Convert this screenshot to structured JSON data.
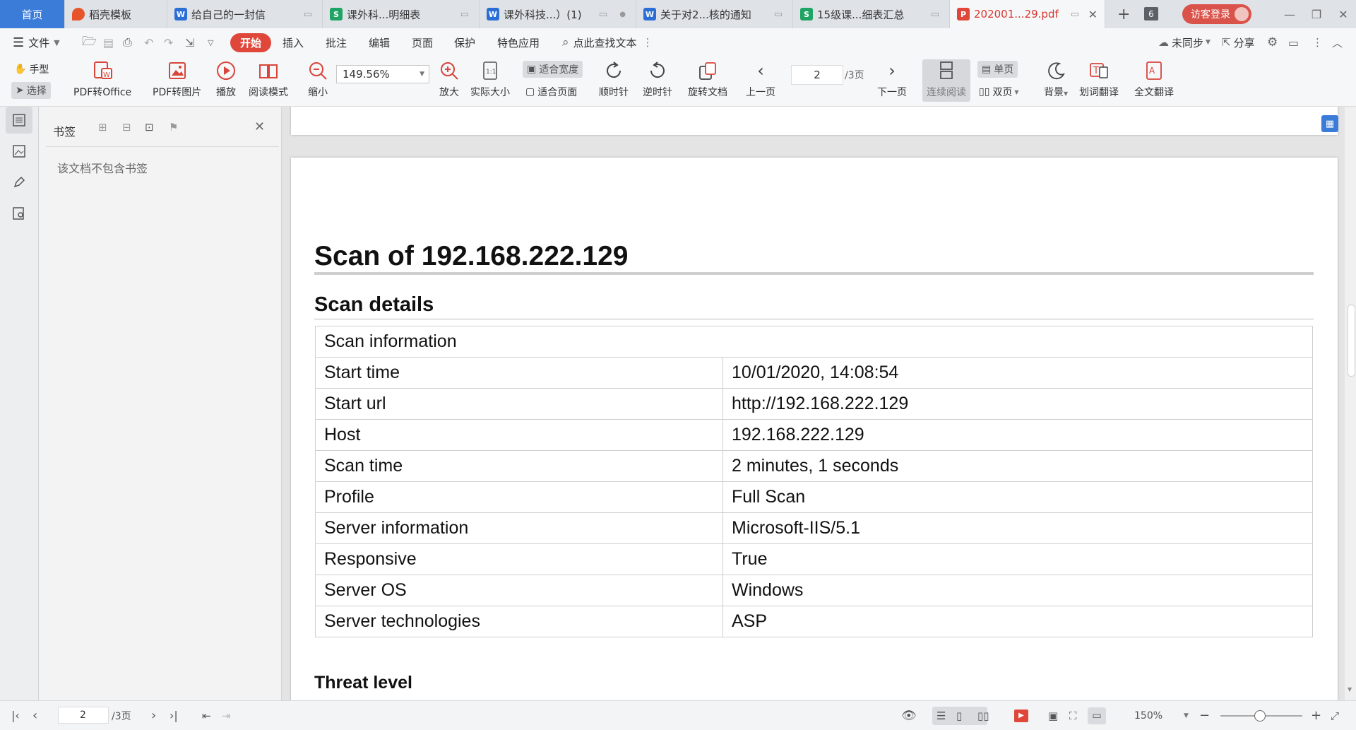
{
  "tabs": [
    {
      "label": "首页",
      "type": "home"
    },
    {
      "label": "稻壳模板",
      "icon": "docer-icon",
      "icon_color": "#e8542a"
    },
    {
      "label": "给自己的一封信",
      "icon": "word-icon",
      "icon_color": "#2b6fd6",
      "state": "cloud-unsynced-icon"
    },
    {
      "label": "课外科...明细表",
      "icon": "sheet-icon",
      "icon_color": "#1fa463",
      "state": "cloud-unsynced-icon"
    },
    {
      "label": "课外科技...）(1)",
      "icon": "word-icon",
      "icon_color": "#2b6fd6",
      "state": "cloud-unsynced-icon"
    },
    {
      "label": "关于对2...核的通知",
      "icon": "word-icon",
      "icon_color": "#2b6fd6",
      "state": "cloud-unsynced-icon"
    },
    {
      "label": "15级课...细表汇总",
      "icon": "sheet-icon",
      "icon_color": "#1fa463",
      "state": "cloud-unsynced-icon"
    },
    {
      "label": "202001...29.pdf",
      "icon": "pdf-icon",
      "icon_color": "#e0473b",
      "state": "cloud-unsynced-icon",
      "active": true
    }
  ],
  "tabbar": {
    "new_tab": "+",
    "tab_count": "6",
    "login_label": "访客登录"
  },
  "menu": {
    "file": "文件",
    "items": [
      "开始",
      "插入",
      "批注",
      "编辑",
      "页面",
      "保护",
      "特色应用"
    ],
    "search_placeholder": "点此查找文本",
    "unsynced": "未同步",
    "share": "分享"
  },
  "ribbon": {
    "hand": "手型",
    "select": "选择",
    "pdf_to_office": "PDF转Office",
    "pdf_to_image": "PDF转图片",
    "play": "播放",
    "read_mode": "阅读模式",
    "zoom_out": "缩小",
    "zoom_value": "149.56%",
    "zoom_in": "放大",
    "actual_size": "实际大小",
    "fit_width": "适合宽度",
    "fit_page": "适合页面",
    "rotate_cw": "顺时针",
    "rotate_ccw": "逆时针",
    "rotate_doc": "旋转文档",
    "prev_page": "上一页",
    "page_input": "2",
    "page_total": "/3页",
    "next_page": "下一页",
    "continuous": "连续阅读",
    "single_page": "单页",
    "double_page": "双页",
    "background": "背景",
    "word_translate": "划词翻译",
    "full_translate": "全文翻译"
  },
  "bookmarks": {
    "title": "书签",
    "empty_text": "该文档不包含书签"
  },
  "document": {
    "heading": "Scan of 192.168.222.129",
    "section1": "Scan details",
    "table_header": "Scan information",
    "rows": [
      {
        "label": "Start time",
        "value": "10/01/2020, 14:08:54"
      },
      {
        "label": "Start url",
        "value": "http://192.168.222.129"
      },
      {
        "label": "Host",
        "value": "192.168.222.129"
      },
      {
        "label": "Scan time",
        "value": "2 minutes, 1 seconds"
      },
      {
        "label": "Profile",
        "value": "Full Scan"
      },
      {
        "label": "Server information",
        "value": "Microsoft-IIS/5.1"
      },
      {
        "label": "Responsive",
        "value": "True"
      },
      {
        "label": "Server OS",
        "value": "Windows"
      },
      {
        "label": "Server technologies",
        "value": "ASP"
      }
    ],
    "section2": "Threat level"
  },
  "statusbar": {
    "page_input": "2",
    "page_total": "/3页",
    "zoom": "150%"
  },
  "colors": {
    "accent_red": "#e0473b",
    "home_tab_blue": "#3b7cd9",
    "active_tab_text": "#d8372f"
  }
}
